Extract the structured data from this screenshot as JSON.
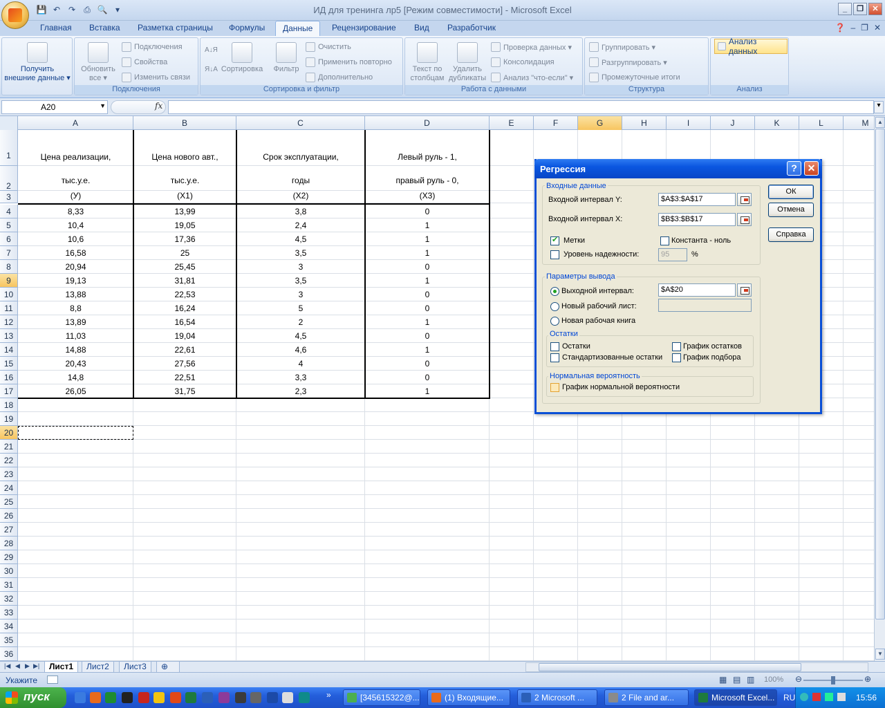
{
  "window": {
    "title": "ИД для тренинга лр5  [Режим совместимости] - Microsoft Excel",
    "controls": [
      "_",
      "❐",
      "✕"
    ]
  },
  "ribbon": {
    "tabs": [
      "Главная",
      "Вставка",
      "Разметка страницы",
      "Формулы",
      "Данные",
      "Рецензирование",
      "Вид",
      "Разработчик"
    ],
    "active_tab": "Данные",
    "groups": {
      "get_external": {
        "line1": "Получить",
        "line2": "внешние данные ▾"
      },
      "connections": {
        "label": "Подключения",
        "refresh_line1": "Обновить",
        "refresh_line2": "все ▾",
        "connections": "Подключения",
        "properties": "Свойства",
        "edit_links": "Изменить связи"
      },
      "sort_filter": {
        "label": "Сортировка и фильтр",
        "sort": "Сортировка",
        "filter": "Фильтр",
        "clear": "Очистить",
        "reapply": "Применить повторно",
        "advanced": "Дополнительно",
        "az": "А↓Я",
        "za": "Я↓А"
      },
      "data_tools": {
        "label": "Работа с данными",
        "text_to_cols_1": "Текст по",
        "text_to_cols_2": "столбцам",
        "remove_dup_1": "Удалить",
        "remove_dup_2": "дубликаты",
        "validation": "Проверка данных ▾",
        "consolidate": "Консолидация",
        "whatif": "Анализ \"что-если\" ▾"
      },
      "outline": {
        "label": "Структура",
        "group": "Группировать ▾",
        "ungroup": "Разгруппировать ▾",
        "subtotal": "Промежуточные итоги"
      },
      "analysis": {
        "label": "Анализ",
        "data_analysis": "Анализ данных"
      }
    }
  },
  "formula_bar": {
    "name_box": "A20",
    "fx": "fx",
    "value": ""
  },
  "columns": [
    "A",
    "B",
    "C",
    "D",
    "E",
    "F",
    "G",
    "H",
    "I",
    "J",
    "K",
    "L",
    "M"
  ],
  "rows": [
    "1",
    "2",
    "3",
    "4",
    "5",
    "6",
    "7",
    "8",
    "9",
    "10",
    "11",
    "12",
    "13",
    "14",
    "15",
    "16",
    "17",
    "18",
    "19",
    "20",
    "21",
    "22",
    "23",
    "24",
    "25",
    "26",
    "27",
    "28",
    "29",
    "30",
    "31",
    "32",
    "33",
    "34",
    "35",
    "36"
  ],
  "headers": {
    "A": {
      "r1": "Цена реализации,",
      "r2": "тыс.у.е.",
      "r3": "(У)"
    },
    "B": {
      "r1": "Цена нового авт.,",
      "r2": "тыс.у.е.",
      "r3": "(Х1)"
    },
    "C": {
      "r1": "Срок эксплуатации,",
      "r2": "годы",
      "r3": "(Х2)"
    },
    "D": {
      "r1": "Левый руль - 1,",
      "r2": "правый руль - 0,",
      "r3": "(Х3)"
    }
  },
  "table": [
    [
      "8,33",
      "13,99",
      "3,8",
      "0"
    ],
    [
      "10,4",
      "19,05",
      "2,4",
      "1"
    ],
    [
      "10,6",
      "17,36",
      "4,5",
      "1"
    ],
    [
      "16,58",
      "25",
      "3,5",
      "1"
    ],
    [
      "20,94",
      "25,45",
      "3",
      "0"
    ],
    [
      "19,13",
      "31,81",
      "3,5",
      "1"
    ],
    [
      "13,88",
      "22,53",
      "3",
      "0"
    ],
    [
      "8,8",
      "16,24",
      "5",
      "0"
    ],
    [
      "13,89",
      "16,54",
      "2",
      "1"
    ],
    [
      "11,03",
      "19,04",
      "4,5",
      "0"
    ],
    [
      "14,88",
      "22,61",
      "4,6",
      "1"
    ],
    [
      "20,43",
      "27,56",
      "4",
      "0"
    ],
    [
      "14,8",
      "22,51",
      "3,3",
      "0"
    ],
    [
      "26,05",
      "31,75",
      "2,3",
      "1"
    ]
  ],
  "dialog": {
    "title": "Регрессия",
    "input_group": "Входные данные",
    "y_label": "Входной интервал Y:",
    "y_value": "$A$3:$A$17",
    "x_label": "Входной интервал X:",
    "x_value": "$B$3:$B$17",
    "labels": "Метки",
    "const_zero": "Константа - ноль",
    "confidence": "Уровень надежности:",
    "confidence_value": "95",
    "percent": "%",
    "output_group": "Параметры вывода",
    "output_range": "Выходной интервал:",
    "output_value": "$A$20",
    "new_sheet": "Новый рабочий лист:",
    "new_book": "Новая рабочая книга",
    "residuals_group": "Остатки",
    "residuals": "Остатки",
    "std_residuals": "Стандартизованные остатки",
    "residual_plot": "График остатков",
    "fit_plot": "График подбора",
    "normal_group": "Нормальная вероятность",
    "normal_plot": "График нормальной вероятности",
    "ok": "ОК",
    "cancel": "Отмена",
    "help": "Справка"
  },
  "sheet_tabs": [
    "Лист1",
    "Лист2",
    "Лист3"
  ],
  "status": {
    "text": "Укажите",
    "zoom": "100%"
  },
  "taskbar": {
    "start": "пуск",
    "tasks": [
      "[345615322@...",
      "(1) Входящие...",
      "2 Microsoft ...",
      "2 File and ar...",
      "Microsoft Excel..."
    ],
    "lang": "RU",
    "clock": "15:56"
  }
}
